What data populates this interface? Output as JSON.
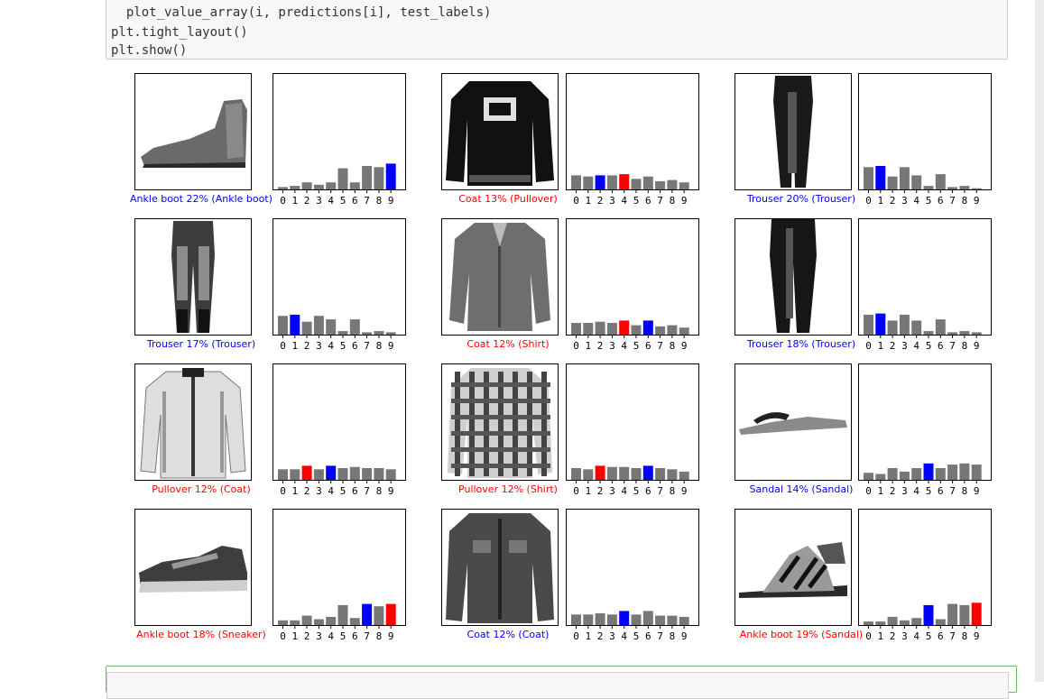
{
  "code": {
    "lines": [
      "  plot_value_array(i, predictions[i], test_labels)",
      "plt.tight_layout()",
      "plt.show()"
    ]
  },
  "tick_labels": [
    "0",
    "1",
    "2",
    "3",
    "4",
    "5",
    "6",
    "7",
    "8",
    "9"
  ],
  "colors": {
    "correct": "#0000ff",
    "wrong": "#ff0000",
    "bar": "#777777"
  },
  "panels": [
    {
      "item": "ankle-boot",
      "caption": "Ankle boot 22% (Ankle boot)",
      "correct": true,
      "pred": 9,
      "true": 9,
      "values": [
        0.02,
        0.03,
        0.06,
        0.04,
        0.06,
        0.18,
        0.06,
        0.2,
        0.19,
        0.22
      ]
    },
    {
      "item": "pullover-coat-graphic",
      "caption": "Coat 13% (Pullover)",
      "correct": false,
      "pred": 4,
      "true": 2,
      "values": [
        0.12,
        0.11,
        0.12,
        0.12,
        0.13,
        0.09,
        0.11,
        0.07,
        0.08,
        0.06
      ]
    },
    {
      "item": "trouser",
      "caption": "Trouser 20% (Trouser)",
      "correct": true,
      "pred": 1,
      "true": 1,
      "values": [
        0.19,
        0.2,
        0.11,
        0.19,
        0.12,
        0.03,
        0.13,
        0.02,
        0.03,
        0.01
      ]
    },
    {
      "item": "trouser-jeans",
      "caption": "Trouser 17% (Trouser)",
      "correct": true,
      "pred": 1,
      "true": 1,
      "values": [
        0.16,
        0.17,
        0.11,
        0.16,
        0.13,
        0.03,
        0.13,
        0.02,
        0.03,
        0.02
      ]
    },
    {
      "item": "shirt",
      "caption": "Coat 12% (Shirt)",
      "correct": false,
      "pred": 4,
      "true": 6,
      "values": [
        0.1,
        0.1,
        0.11,
        0.1,
        0.12,
        0.08,
        0.12,
        0.07,
        0.08,
        0.06
      ]
    },
    {
      "item": "trouser-dark",
      "caption": "Trouser 18% (Trouser)",
      "correct": true,
      "pred": 1,
      "true": 1,
      "values": [
        0.17,
        0.18,
        0.12,
        0.17,
        0.12,
        0.03,
        0.13,
        0.02,
        0.03,
        0.02
      ]
    },
    {
      "item": "coat-light",
      "caption": "Pullover 12% (Coat)",
      "correct": false,
      "pred": 2,
      "true": 4,
      "values": [
        0.09,
        0.09,
        0.12,
        0.09,
        0.12,
        0.1,
        0.11,
        0.1,
        0.1,
        0.09
      ]
    },
    {
      "item": "shirt-plaid",
      "caption": "Pullover 12% (Shirt)",
      "correct": false,
      "pred": 2,
      "true": 6,
      "values": [
        0.1,
        0.09,
        0.12,
        0.11,
        0.11,
        0.1,
        0.12,
        0.1,
        0.09,
        0.07
      ]
    },
    {
      "item": "sandal-flat",
      "caption": "Sandal 14% (Sandal)",
      "correct": true,
      "pred": 5,
      "true": 5,
      "values": [
        0.06,
        0.05,
        0.1,
        0.07,
        0.1,
        0.14,
        0.1,
        0.13,
        0.14,
        0.13
      ]
    },
    {
      "item": "sneaker",
      "caption": "Ankle boot 18% (Sneaker)",
      "correct": false,
      "pred": 9,
      "true": 7,
      "values": [
        0.04,
        0.04,
        0.08,
        0.05,
        0.07,
        0.17,
        0.06,
        0.18,
        0.16,
        0.18
      ]
    },
    {
      "item": "coat-denim",
      "caption": "Coat 12% (Coat)",
      "correct": true,
      "pred": 4,
      "true": 4,
      "values": [
        0.09,
        0.09,
        0.1,
        0.09,
        0.12,
        0.09,
        0.12,
        0.08,
        0.08,
        0.07
      ]
    },
    {
      "item": "sandal-strappy",
      "caption": "Ankle boot 19% (Sandal)",
      "correct": false,
      "pred": 9,
      "true": 5,
      "values": [
        0.03,
        0.03,
        0.07,
        0.04,
        0.06,
        0.17,
        0.05,
        0.18,
        0.17,
        0.19
      ]
    }
  ]
}
